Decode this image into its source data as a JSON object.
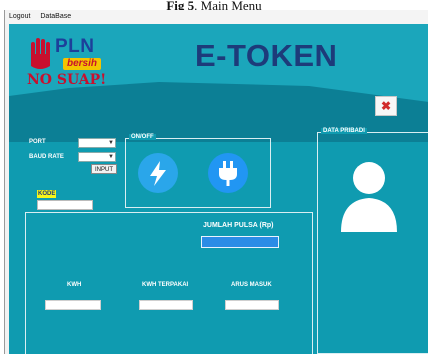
{
  "caption": {
    "prefix": "Fig 5",
    "text": ". Main Menu"
  },
  "menu": {
    "items": [
      "Logout",
      "DataBase"
    ]
  },
  "logo": {
    "pln": "PLN",
    "bersih": "bersih",
    "slogan": "NO SUAP!"
  },
  "header": {
    "title": "E-TOKEN"
  },
  "close_button": {
    "symbol": "✖"
  },
  "connection": {
    "port_label": "PORT",
    "baud_label": "BAUD RATE",
    "port_value": "",
    "baud_value": "",
    "input_button": "INPUT"
  },
  "kode": {
    "label": "KODE",
    "value": ""
  },
  "onoff": {
    "title": "ON/OFF",
    "buttons": [
      "bolt-icon",
      "plug-icon"
    ]
  },
  "data_pribadi": {
    "title": "DATA PRIBADI"
  },
  "readings": {
    "jumlah_pulsa_label": "JUMLAH PULSA (Rp)",
    "jumlah_pulsa_value": "",
    "kwh_label": "KWH",
    "kwh_value": "",
    "kwh_terpakai_label": "KWH TERPAKAI",
    "kwh_terpakai_value": "",
    "arus_masuk_label": "ARUS MASUK",
    "arus_masuk_value": ""
  },
  "colors": {
    "client_bg": "#0f9bb0",
    "header_light": "#1ba6bb",
    "header_dark": "#0c7f95",
    "title": "#1d3b7a",
    "accent_blue": "#2196f3"
  }
}
